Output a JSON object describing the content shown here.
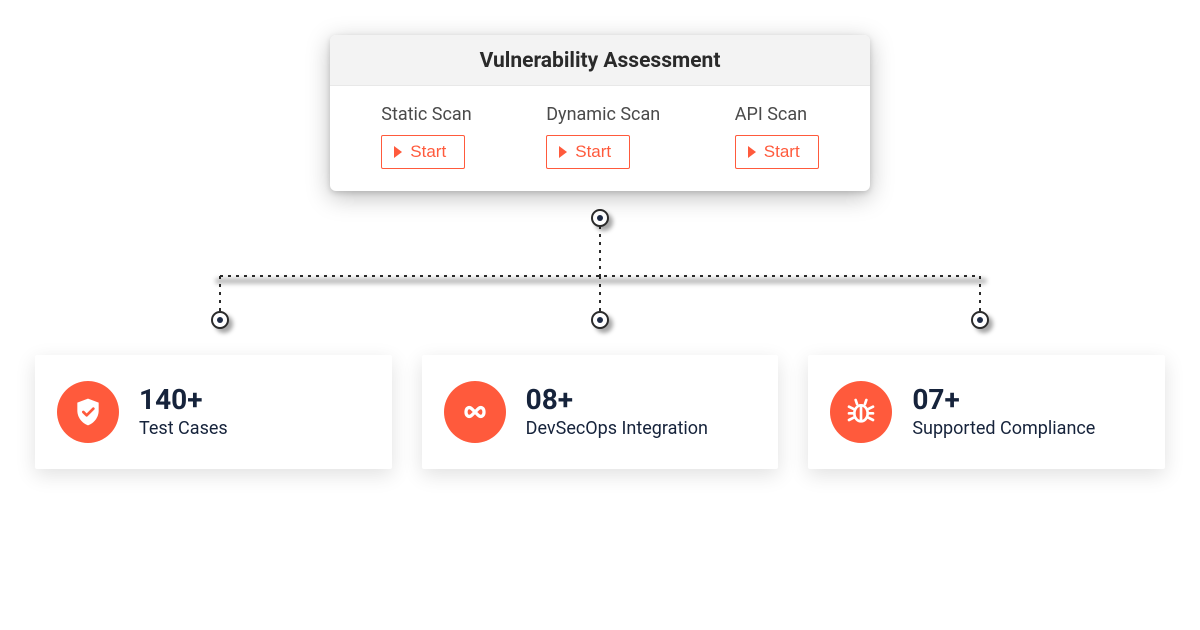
{
  "panel": {
    "title": "Vulnerability Assessment",
    "scans": [
      {
        "label": "Static Scan",
        "button": "Start"
      },
      {
        "label": "Dynamic Scan",
        "button": "Start"
      },
      {
        "label": "API Scan",
        "button": "Start"
      }
    ]
  },
  "stats": [
    {
      "count": "140+",
      "label": "Test Cases",
      "icon": "shield-check-icon"
    },
    {
      "count": "08+",
      "label": "DevSecOps Integration",
      "icon": "infinity-icon"
    },
    {
      "count": "07+",
      "label": "Supported Compliance",
      "icon": "bug-icon"
    }
  ],
  "colors": {
    "accent": "#ff5a3c",
    "dark": "#16233b"
  }
}
